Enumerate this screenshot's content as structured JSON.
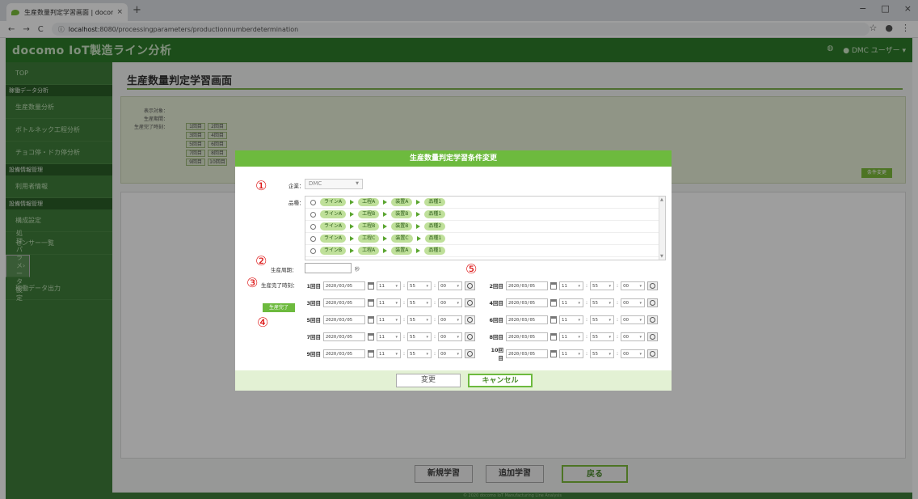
{
  "browser": {
    "tab_title": "生産数量判定学習画面 | docomo",
    "tab_close": "×",
    "new_tab": "+",
    "url_host": "localhost",
    "url_rest": ":8080/processingparameters/productionnumberdetermination",
    "window_controls": [
      "−",
      "□",
      "×"
    ]
  },
  "app": {
    "brand": "docomo IoT製造ライン分析",
    "user": "DMC ユーザー",
    "footer": "© 2020 docomo IoT Manufacturing Line Analysis"
  },
  "sidebar": {
    "top": "TOP",
    "sec1": "稼働データ分析",
    "items1": [
      "生産数量分析",
      "ボトルネック工程分析",
      "チョコ停・ドカ停分析"
    ],
    "sec2": "設備情報管理",
    "items2": [
      "利用者情報"
    ],
    "sec3": "設備情報管理",
    "items3": [
      "構成設定",
      "センサー一覧",
      "処理パラメータ設定",
      "稼働データ出力"
    ],
    "selected_arrow": "›"
  },
  "main": {
    "title": "生産数量判定学習画面",
    "cond_labels": [
      "表示対象：",
      "生産期間：",
      "生産完了時刻："
    ],
    "cond_cells": [
      "1回目",
      "2回目",
      "3回目",
      "4回目",
      "5回目",
      "6回目",
      "7回目",
      "8回目",
      "9回目",
      "10回目"
    ],
    "cond_button": "条件変更",
    "buttons": {
      "new": "新規学習",
      "add": "追加学習",
      "back": "戻る"
    }
  },
  "modal": {
    "title": "生産数量判定学習条件変更",
    "company_label": "企業：",
    "company_value": "DMC",
    "product_label": "品種：",
    "products": [
      [
        "ラインA",
        "工程A",
        "装置A",
        "品種1"
      ],
      [
        "ラインA",
        "工程B",
        "装置B",
        "品種1"
      ],
      [
        "ラインA",
        "工程B",
        "装置B",
        "品種2"
      ],
      [
        "ラインA",
        "工程C",
        "装置C",
        "品種1"
      ],
      [
        "ラインB",
        "工程A",
        "装置A",
        "品種1"
      ]
    ],
    "cycle_label": "生産周期：",
    "cycle_unit": "秒",
    "completion_label": "生産完了時刻：",
    "produce_done": "生産完了",
    "rows": [
      {
        "n": "1回目",
        "date": "2020/03/05",
        "h": "11",
        "m": "55",
        "s": "00"
      },
      {
        "n": "2回目",
        "date": "2020/03/05",
        "h": "11",
        "m": "55",
        "s": "00"
      },
      {
        "n": "3回目",
        "date": "2020/03/05",
        "h": "11",
        "m": "55",
        "s": "00"
      },
      {
        "n": "4回目",
        "date": "2020/03/05",
        "h": "11",
        "m": "55",
        "s": "00"
      },
      {
        "n": "5回目",
        "date": "2020/03/05",
        "h": "11",
        "m": "55",
        "s": "00"
      },
      {
        "n": "6回目",
        "date": "2020/03/05",
        "h": "11",
        "m": "55",
        "s": "00"
      },
      {
        "n": "7回目",
        "date": "2020/03/05",
        "h": "11",
        "m": "55",
        "s": "00"
      },
      {
        "n": "8回目",
        "date": "2020/03/05",
        "h": "11",
        "m": "55",
        "s": "00"
      },
      {
        "n": "9回目",
        "date": "2020/03/05",
        "h": "11",
        "m": "55",
        "s": "00"
      },
      {
        "n": "10回目",
        "date": "2020/03/05",
        "h": "11",
        "m": "55",
        "s": "00"
      }
    ],
    "change_button": "変更",
    "cancel_button": "キャンセル",
    "markers": [
      "①",
      "②",
      "③",
      "④",
      "⑤"
    ]
  }
}
